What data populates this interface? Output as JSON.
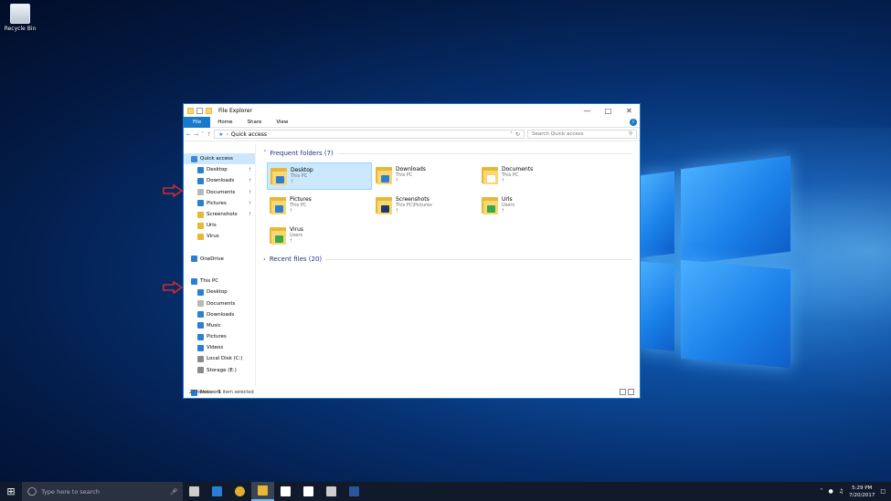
{
  "desktop": {
    "recycle_bin_label": "Recycle Bin"
  },
  "window": {
    "title": "File Explorer",
    "minimize_icon": "minimize-icon",
    "maximize_icon": "maximize-icon",
    "close_icon": "close-icon",
    "ribbon_tabs": [
      "File",
      "Home",
      "Share",
      "View"
    ],
    "address_path": "Quick access",
    "search_placeholder": "Search Quick access"
  },
  "nav": {
    "items": [
      {
        "label": "Quick access",
        "icon": "star-icon",
        "color": "#3a8bd6",
        "indent": 0,
        "selected": true,
        "pinned": false
      },
      {
        "label": "Desktop",
        "icon": "desktop-icon",
        "color": "#2a7fd4",
        "indent": 1,
        "pinned": true
      },
      {
        "label": "Downloads",
        "icon": "download-icon",
        "color": "#2a7fd4",
        "indent": 1,
        "pinned": true
      },
      {
        "label": "Documents",
        "icon": "documents-icon",
        "color": "#b8b8b8",
        "indent": 1,
        "pinned": true
      },
      {
        "label": "Pictures",
        "icon": "pictures-icon",
        "color": "#2a7fd4",
        "indent": 1,
        "pinned": true
      },
      {
        "label": "Screenshots",
        "icon": "folder-icon",
        "color": "#e8b835",
        "indent": 1,
        "pinned": true
      },
      {
        "label": "Urls",
        "icon": "folder-icon",
        "color": "#e8b835",
        "indent": 1,
        "pinned": false
      },
      {
        "label": "Virus",
        "icon": "folder-icon",
        "color": "#e8b835",
        "indent": 1,
        "pinned": false
      },
      {
        "label": "",
        "icon": "",
        "color": "",
        "indent": 0,
        "pinned": false
      },
      {
        "label": "OneDrive",
        "icon": "cloud-icon",
        "color": "#2a7fd4",
        "indent": 0,
        "pinned": false
      },
      {
        "label": "",
        "icon": "",
        "color": "",
        "indent": 0,
        "pinned": false
      },
      {
        "label": "This PC",
        "icon": "computer-icon",
        "color": "#2a7fd4",
        "indent": 0,
        "pinned": false
      },
      {
        "label": "Desktop",
        "icon": "desktop-icon",
        "color": "#2a7fd4",
        "indent": 1,
        "pinned": false
      },
      {
        "label": "Documents",
        "icon": "documents-icon",
        "color": "#b8b8b8",
        "indent": 1,
        "pinned": false
      },
      {
        "label": "Downloads",
        "icon": "download-icon",
        "color": "#2a7fd4",
        "indent": 1,
        "pinned": false
      },
      {
        "label": "Music",
        "icon": "music-icon",
        "color": "#2a7fd4",
        "indent": 1,
        "pinned": false
      },
      {
        "label": "Pictures",
        "icon": "pictures-icon",
        "color": "#2a7fd4",
        "indent": 1,
        "pinned": false
      },
      {
        "label": "Videos",
        "icon": "videos-icon",
        "color": "#2a7fd4",
        "indent": 1,
        "pinned": false
      },
      {
        "label": "Local Disk (C:)",
        "icon": "drive-icon",
        "color": "#8a8a8a",
        "indent": 1,
        "pinned": false
      },
      {
        "label": "Storage (E:)",
        "icon": "drive-icon",
        "color": "#8a8a8a",
        "indent": 1,
        "pinned": false
      },
      {
        "label": "",
        "icon": "",
        "color": "",
        "indent": 0,
        "pinned": false
      },
      {
        "label": "Network",
        "icon": "network-icon",
        "color": "#2a7fd4",
        "indent": 0,
        "pinned": false
      }
    ]
  },
  "content": {
    "frequent_header": "Frequent folders (7)",
    "recent_header": "Recent files (20)",
    "folders": [
      {
        "name": "Desktop",
        "location": "This PC",
        "overlay": "#2a7fd4",
        "selected": true
      },
      {
        "name": "Downloads",
        "location": "This PC",
        "overlay": "#2a7fd4",
        "selected": false
      },
      {
        "name": "Documents",
        "location": "This PC",
        "overlay": "#ffffff",
        "selected": false
      },
      {
        "name": "Pictures",
        "location": "This PC",
        "overlay": "#2a7fd4",
        "selected": false
      },
      {
        "name": "Screenshots",
        "location": "This PC\\Pictures",
        "overlay": "#1d3a6b",
        "selected": false
      },
      {
        "name": "Urls",
        "location": "Users",
        "overlay": "#3aa84a",
        "selected": false
      },
      {
        "name": "Virus",
        "location": "Users",
        "overlay": "#3aa84a",
        "selected": false
      }
    ]
  },
  "status": {
    "item_count": "27 items",
    "selection": "1 item selected"
  },
  "taskbar": {
    "search_placeholder": "Type here to search",
    "apps": [
      {
        "name": "task-view-icon",
        "color": "#cccccc",
        "active": false
      },
      {
        "name": "edge-icon",
        "color": "#2a7fd4",
        "active": false
      },
      {
        "name": "chrome-icon",
        "color": "#e0b030",
        "active": false
      },
      {
        "name": "file-explorer-icon",
        "color": "#e8b835",
        "active": true
      },
      {
        "name": "store-icon",
        "color": "#ffffff",
        "active": false
      },
      {
        "name": "mail-icon",
        "color": "#ffffff",
        "active": false
      },
      {
        "name": "calculator-icon",
        "color": "#cccccc",
        "active": false
      },
      {
        "name": "word-icon",
        "color": "#2b579a",
        "active": false
      }
    ],
    "time": "5:29 PM",
    "date": "7/20/2017"
  },
  "annotations": {
    "arrow_color": "#d42a2a"
  }
}
